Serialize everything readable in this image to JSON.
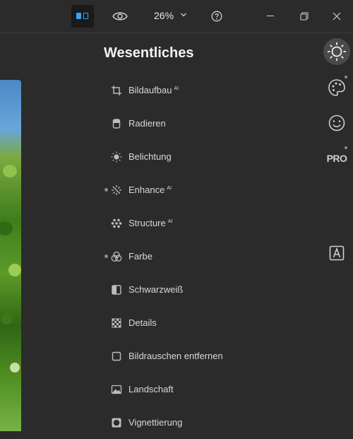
{
  "topbar": {
    "zoom": "26%"
  },
  "panel": {
    "title": "Wesentliches",
    "ai_badge": "AI",
    "tools": [
      {
        "label": "Bildaufbau",
        "ai": true,
        "icon": "crop-icon"
      },
      {
        "label": "Radieren",
        "ai": false,
        "icon": "eraser-icon"
      },
      {
        "label": "Belichtung",
        "ai": false,
        "icon": "sun-icon"
      },
      {
        "label": "Enhance",
        "ai": true,
        "icon": "sparkle-icon"
      },
      {
        "label": "Structure",
        "ai": true,
        "icon": "structure-icon"
      },
      {
        "label": "Farbe",
        "ai": false,
        "icon": "color-circles-icon"
      },
      {
        "label": "Schwarzweiß",
        "ai": false,
        "icon": "black-white-icon"
      },
      {
        "label": "Details",
        "ai": false,
        "icon": "details-checker-icon"
      },
      {
        "label": "Bildrauschen entfernen",
        "ai": false,
        "icon": "denoise-icon"
      },
      {
        "label": "Landschaft",
        "ai": false,
        "icon": "landscape-icon"
      },
      {
        "label": "Vignettierung",
        "ai": false,
        "icon": "vignette-icon"
      }
    ]
  },
  "rail": {
    "pro_label": "PRO"
  },
  "colors": {
    "background": "#2b2b2b",
    "accent": "#2fa4ff",
    "text": "#d8d8d8"
  }
}
